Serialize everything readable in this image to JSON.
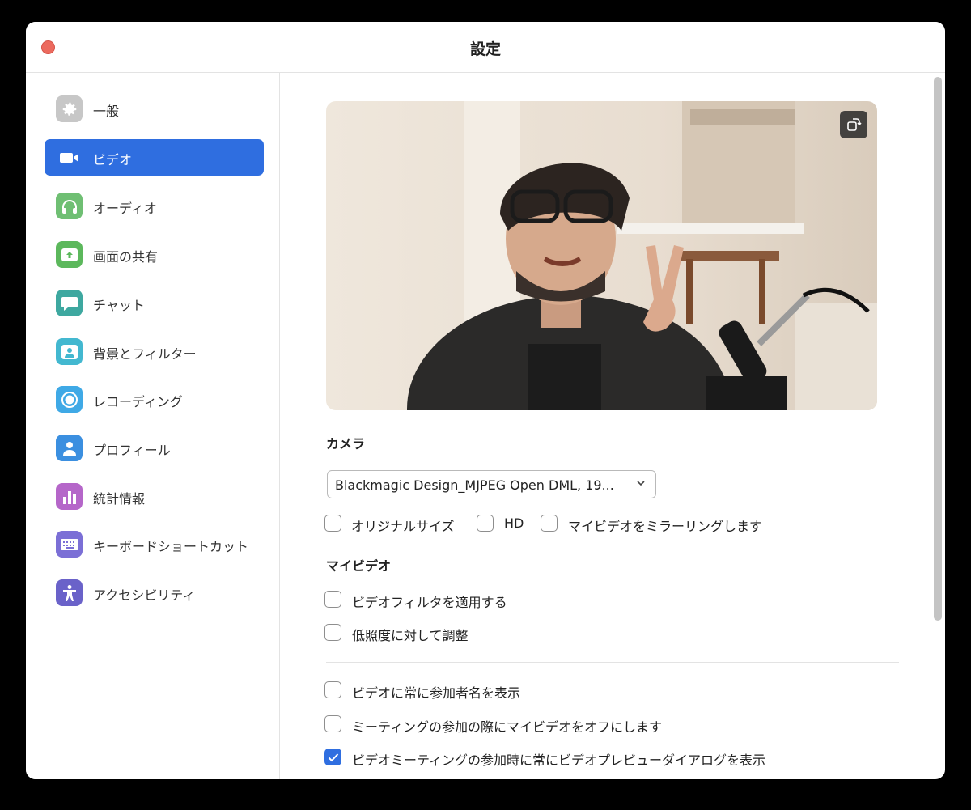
{
  "window": {
    "title": "設定"
  },
  "sidebar": {
    "items": [
      {
        "label": "一般",
        "icon": "gear-icon",
        "color": "#c7c7c7",
        "active": false
      },
      {
        "label": "ビデオ",
        "icon": "video-camera-icon",
        "color": "#2f6ee0",
        "active": true
      },
      {
        "label": "オーディオ",
        "icon": "headphones-icon",
        "color": "#6fbf73",
        "active": false
      },
      {
        "label": "画面の共有",
        "icon": "share-screen-icon",
        "color": "#5cb85c",
        "active": false
      },
      {
        "label": "チャット",
        "icon": "chat-bubble-icon",
        "color": "#3ea8a0",
        "active": false
      },
      {
        "label": "背景とフィルター",
        "icon": "background-person-icon",
        "color": "#43b8d0",
        "active": false
      },
      {
        "label": "レコーディング",
        "icon": "record-icon",
        "color": "#3fa9e6",
        "active": false
      },
      {
        "label": "プロフィール",
        "icon": "profile-icon",
        "color": "#3b8fe0",
        "active": false
      },
      {
        "label": "統計情報",
        "icon": "statistics-icon",
        "color": "#b566c9",
        "active": false
      },
      {
        "label": "キーボードショートカット",
        "icon": "keyboard-icon",
        "color": "#7b6fd6",
        "active": false
      },
      {
        "label": "アクセシビリティ",
        "icon": "accessibility-icon",
        "color": "#6a62c9",
        "active": false
      }
    ]
  },
  "main": {
    "camera_label": "カメラ",
    "camera_select": "Blackmagic Design_MJPEG Open DML, 19...",
    "camera_options": [
      {
        "label": "オリジナルサイズ",
        "checked": false
      },
      {
        "label": "HD",
        "checked": false
      },
      {
        "label": "マイビデオをミラーリングします",
        "checked": false
      }
    ],
    "my_video_label": "マイビデオ",
    "my_video_options": [
      {
        "label": "ビデオフィルタを適用する",
        "checked": false
      },
      {
        "label": "低照度に対して調整",
        "checked": false
      }
    ],
    "more_options": [
      {
        "label": "ビデオに常に参加者名を表示",
        "checked": false
      },
      {
        "label": "ミーティングの参加の際にマイビデオをオフにします",
        "checked": false
      },
      {
        "label": "ビデオミーティングの参加時に常にビデオプレビューダイアログを表示",
        "checked": true
      }
    ]
  },
  "colors": {
    "accent": "#2f6ee0",
    "close": "#ec6a5e"
  }
}
